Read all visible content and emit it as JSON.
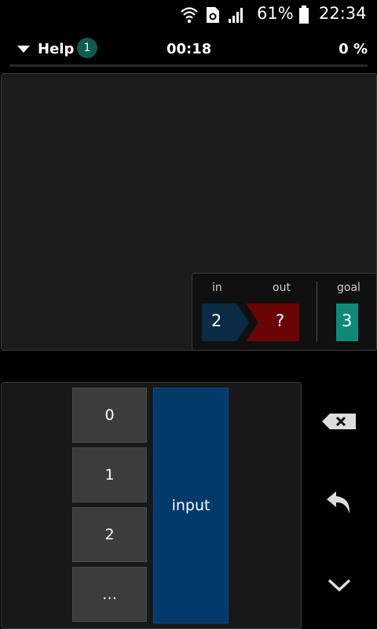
{
  "status_bar": {
    "battery_percent": "61%",
    "time": "22:34",
    "icons": [
      "wifi-icon",
      "sim-icon",
      "signal-icon",
      "battery-icon"
    ]
  },
  "top_bar": {
    "help_label": "Help",
    "help_badge": "1",
    "timer": "00:18",
    "percent": "0 %"
  },
  "io_panel": {
    "in_label": "in",
    "out_label": "out",
    "goal_label": "goal",
    "in_value": "2",
    "out_value": "?",
    "goal_value": "3"
  },
  "palette": {
    "numbers": [
      "0",
      "1",
      "2",
      "…"
    ],
    "input_label": "input"
  },
  "side_controls": [
    "backspace-icon",
    "undo-icon",
    "chevron-down-icon"
  ],
  "colors": {
    "accent_teal": "#0f8a78",
    "badge": "#0e5a4e",
    "input_blue": "#023a6a",
    "in_chevron": "#0b2b46",
    "out_chevron": "#6b0505"
  }
}
